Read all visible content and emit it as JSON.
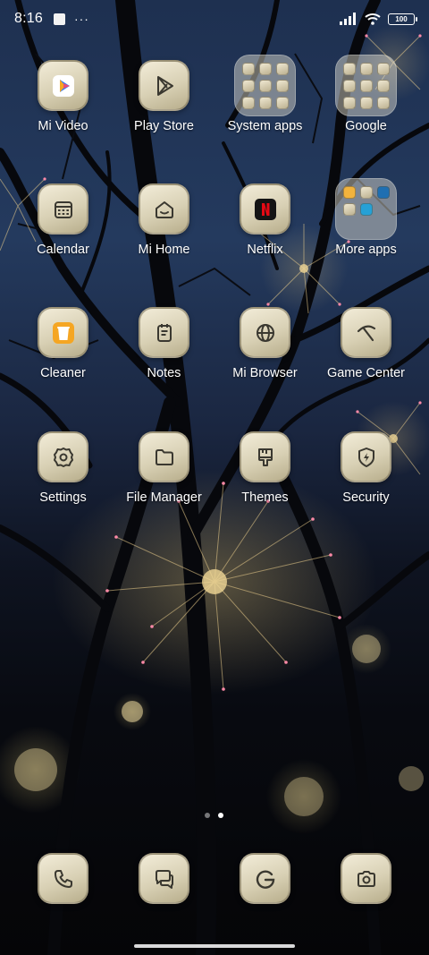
{
  "status_bar": {
    "time": "8:16",
    "more": "···",
    "battery": "100"
  },
  "apps": [
    {
      "label": "Mi Video",
      "icon": "mi-video-icon"
    },
    {
      "label": "Play Store",
      "icon": "play-store-icon"
    },
    {
      "label": "System apps",
      "icon": "folder-icon"
    },
    {
      "label": "Google",
      "icon": "folder-icon"
    },
    {
      "label": "Calendar",
      "icon": "calendar-icon"
    },
    {
      "label": "Mi Home",
      "icon": "home-icon"
    },
    {
      "label": "Netflix",
      "icon": "netflix-icon",
      "brand_color": "#E50914"
    },
    {
      "label": "More apps",
      "icon": "folder-icon"
    },
    {
      "label": "Cleaner",
      "icon": "trash-icon",
      "brand_color": "#F5A623"
    },
    {
      "label": "Notes",
      "icon": "notes-icon"
    },
    {
      "label": "Mi Browser",
      "icon": "globe-icon"
    },
    {
      "label": "Game Center",
      "icon": "game-center-icon"
    },
    {
      "label": "Settings",
      "icon": "gear-icon"
    },
    {
      "label": "File Manager",
      "icon": "folder-outline-icon"
    },
    {
      "label": "Themes",
      "icon": "brush-icon"
    },
    {
      "label": "Security",
      "icon": "shield-bolt-icon"
    }
  ],
  "page_indicator": {
    "pages": 2,
    "current": 2
  },
  "dock": [
    {
      "icon": "phone-icon"
    },
    {
      "icon": "messages-icon"
    },
    {
      "icon": "google-icon"
    },
    {
      "icon": "camera-icon"
    }
  ]
}
